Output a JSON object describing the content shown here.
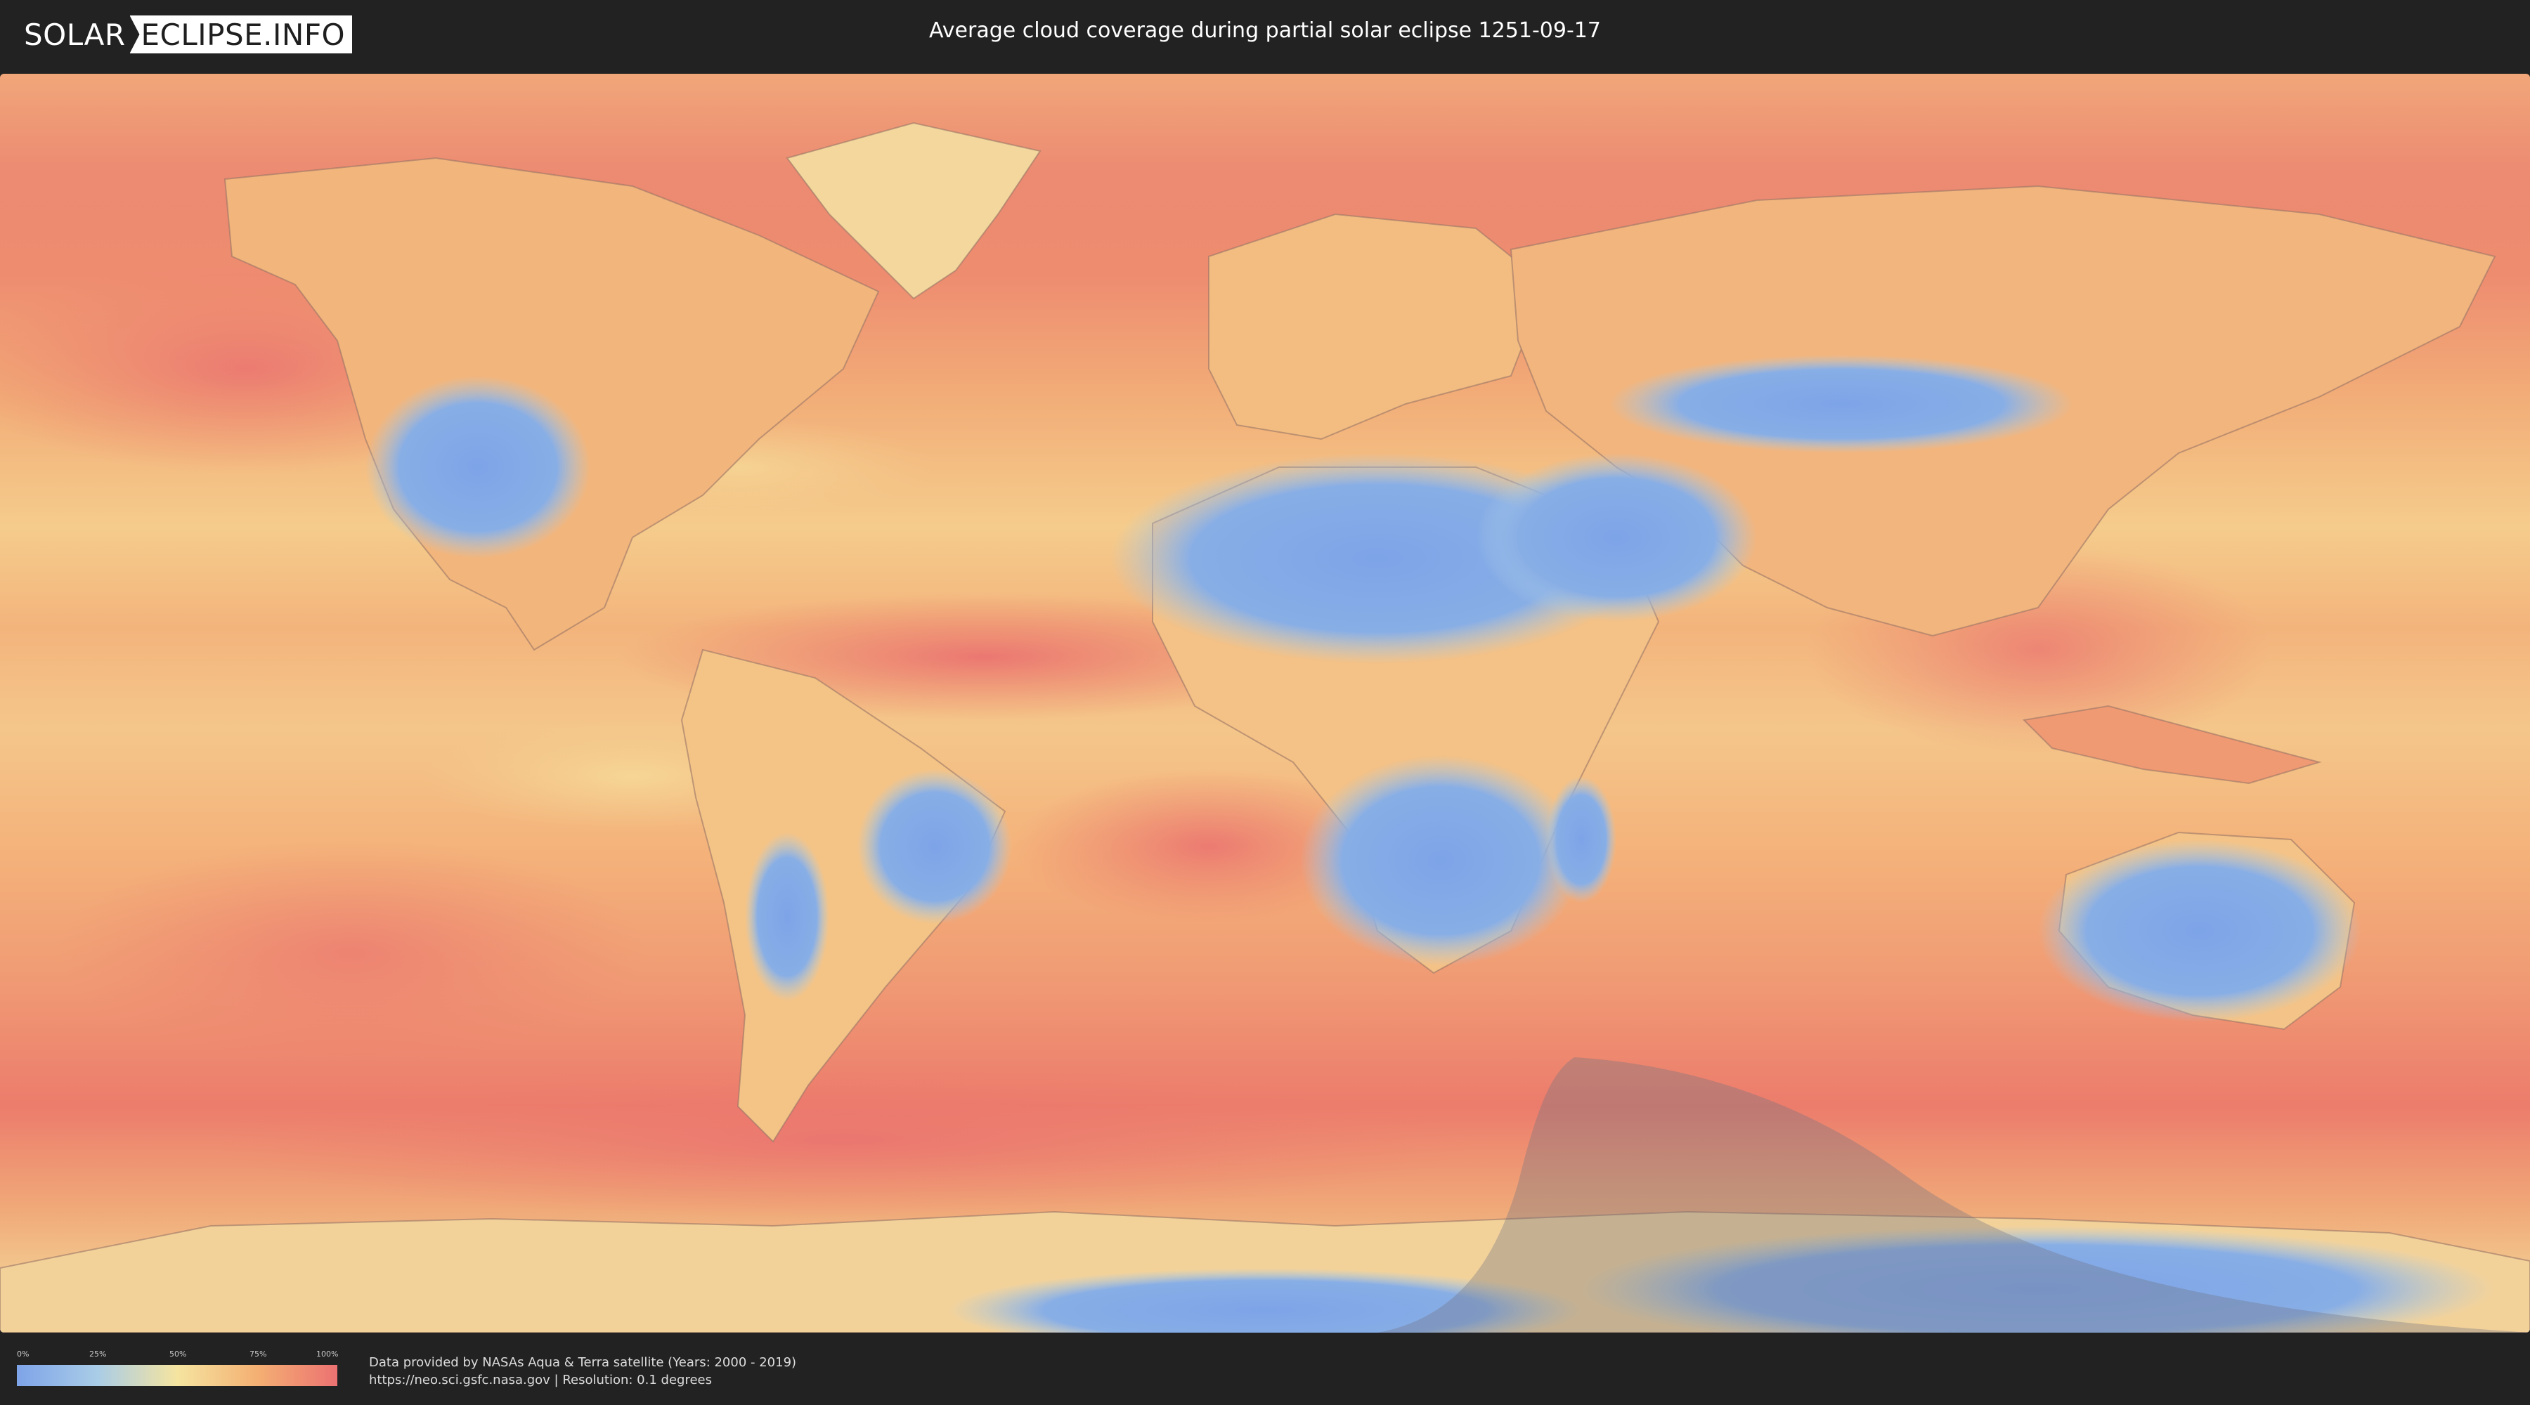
{
  "header": {
    "logo_left": "SOLAR",
    "logo_right": "ECLIPSE.INFO",
    "title": "Average cloud coverage during partial solar eclipse 1251-09-17"
  },
  "map": {
    "map_type": "world cloud coverage (equirectangular)",
    "colors": {
      "ocean_cloudy": "#ec7c6c",
      "ocean_mid": "#f4b27a",
      "clear_land": "#7ea4e8",
      "partial": "#f5e4a0",
      "eclipse_overlay": "#6e7a8a",
      "coastline": "#8a6a5a"
    }
  },
  "legend": {
    "ticks": [
      "0%",
      "25%",
      "50%",
      "75%",
      "100%"
    ],
    "colors": [
      "#7ea4e8",
      "#a9cce7",
      "#f5e4a0",
      "#f4b073",
      "#ec7272"
    ]
  },
  "credits": {
    "line1": "Data provided by NASAs Aqua & Terra satellite (Years: 2000 - 2019)",
    "line2": "https://neo.sci.gsfc.nasa.gov | Resolution: 0.1 degrees"
  }
}
